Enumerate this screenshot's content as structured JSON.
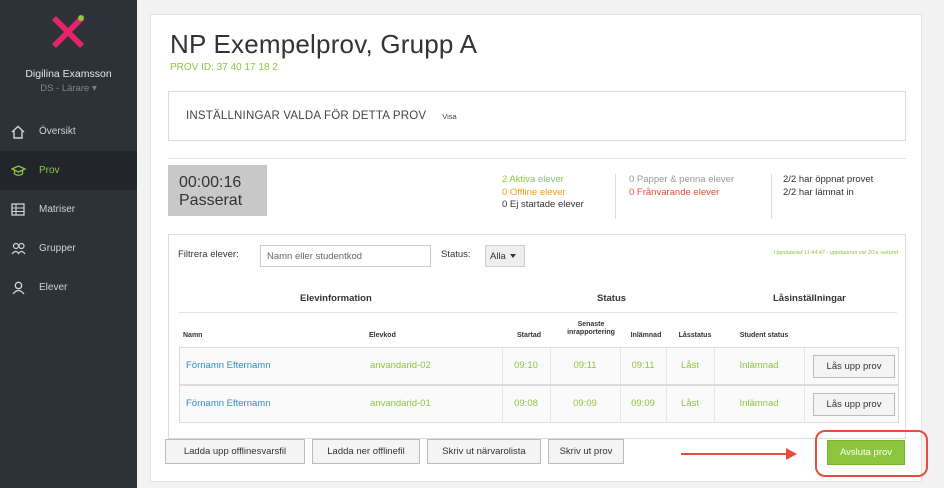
{
  "sidebar": {
    "user_name": "Digilina Examsson",
    "user_role": "DS - Lärare",
    "items": [
      {
        "label": "Översikt",
        "icon": "home-icon",
        "active": false
      },
      {
        "label": "Prov",
        "icon": "graduation-cap-icon",
        "active": true
      },
      {
        "label": "Matriser",
        "icon": "grid-icon",
        "active": false
      },
      {
        "label": "Grupper",
        "icon": "group-icon",
        "active": false
      },
      {
        "label": "Elever",
        "icon": "user-icon",
        "active": false
      }
    ]
  },
  "header": {
    "title": "NP Exempelprov, Grupp A",
    "prov_id": "PROV ID: 37 40 17 18 2"
  },
  "settings": {
    "title": "INSTÄLLNINGAR VALDA FÖR DETTA PROV",
    "link": "Visa"
  },
  "timer": {
    "time": "00:00:16",
    "label": "Passerat"
  },
  "stats": {
    "active": "2 Aktiva elever",
    "offline": "0 Offline elever",
    "not_started": "0 Ej startade elever",
    "paper": "0 Papper & penna elever",
    "absent": "0 Frånvarande elever",
    "opened": "2/2 har öppnat provet",
    "submitted": "2/2 har lämnat in"
  },
  "filter": {
    "label": "Filtrera elever:",
    "placeholder": "Namn eller studentkod",
    "status_label": "Status:",
    "status_value": "Alla",
    "updated": "Uppdaterad 11:44:47 - uppdateras var 20:e sekund"
  },
  "table": {
    "groups": {
      "elevinfo": "Elevinformation",
      "status": "Status",
      "lock": "Låsinställningar"
    },
    "columns": {
      "name": "Namn",
      "code": "Elevkod",
      "started": "Startad",
      "last_report_1": "Senaste",
      "last_report_2": "inrapportering",
      "submitted": "Inlämnad",
      "lock_status": "Låsstatus",
      "student_status": "Student status"
    },
    "rows": [
      {
        "name": "Förnamn Efternamn",
        "code": "anvandarid-02",
        "started": "09:10",
        "last_report": "09:11",
        "submitted": "09:11",
        "lock_status": "Låst",
        "student_status": "Inlämnad",
        "action": "Lås upp prov"
      },
      {
        "name": "Förnamn Efternamn",
        "code": "anvandarid-01",
        "started": "09:08",
        "last_report": "09:09",
        "submitted": "09:09",
        "lock_status": "Låst",
        "student_status": "Inlämnad",
        "action": "Lås upp prov"
      }
    ]
  },
  "buttons": {
    "upload": "Ladda upp offlinesvarsfil",
    "download": "Ladda ner offlinefil",
    "print_attendance": "Skriv ut närvarolista",
    "print_exam": "Skriv ut prov",
    "end": "Avsluta prov"
  },
  "colors": {
    "accent": "#8cc63f",
    "sidebar": "#2d3238",
    "link": "#2d8fc1",
    "warning": "#f39c12",
    "danger": "#e74c3c"
  }
}
